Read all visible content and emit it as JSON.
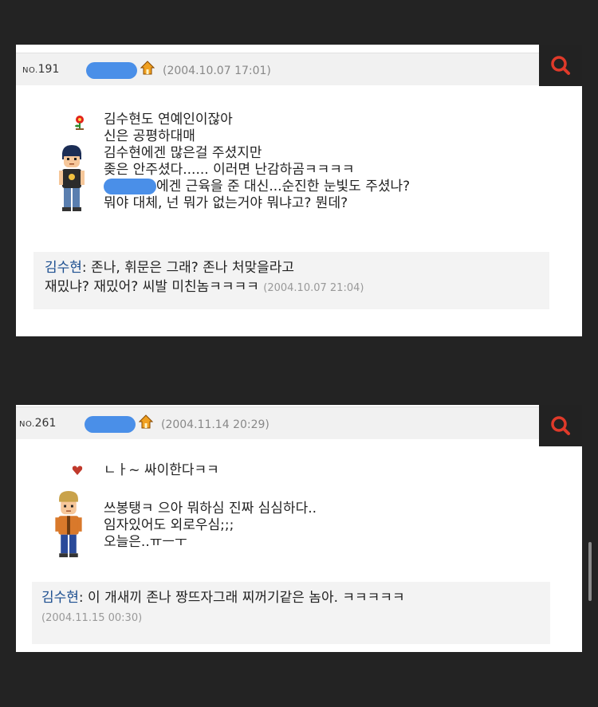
{
  "posts": [
    {
      "no_prefix": "NO.",
      "no": "191",
      "date": "(2004.10.07 17:01)",
      "lines": [
        "김수현도 연예인이잖아",
        "신은 공평하대매",
        "김수현에겐 많은걸 주셨지만",
        "좆은 안주셨다...... 이러면 난감하곰ㅋㅋㅋㅋ",
        "에겐 근육을 준 대신...순진한 눈빛도 주셨나?",
        "뭐야 대체, 넌 뭐가 없는거야 뭐냐고? 뭔데?"
      ],
      "comment_author": "김수현",
      "comment_line1": ": 존나, 휘문은 그래? 존나 처맞을라고",
      "comment_line2": "재밌냐? 재밌어? 씨발 미친놈ㅋㅋㅋㅋ",
      "comment_date": "(2004.10.07 21:04)"
    },
    {
      "no_prefix": "NO.",
      "no": "261",
      "date": "(2004.11.14 20:29)",
      "lines": [
        "ㄴㅏ~ 싸이한다ㅋㅋ",
        "쓰봉탱ㅋ 으아 뭐하심 진짜 심심하다..",
        "임자있어도 외로우심;;;",
        "오늘은..ㅠㅡㅜ"
      ],
      "comment_author": "김수현",
      "comment_line1": ": 이 개새끼 존나 짱뜨자그래 찌꺼기같은 놈아. ㅋㅋㅋㅋㅋ",
      "comment_date": "(2004.11.15 00:30)"
    }
  ]
}
